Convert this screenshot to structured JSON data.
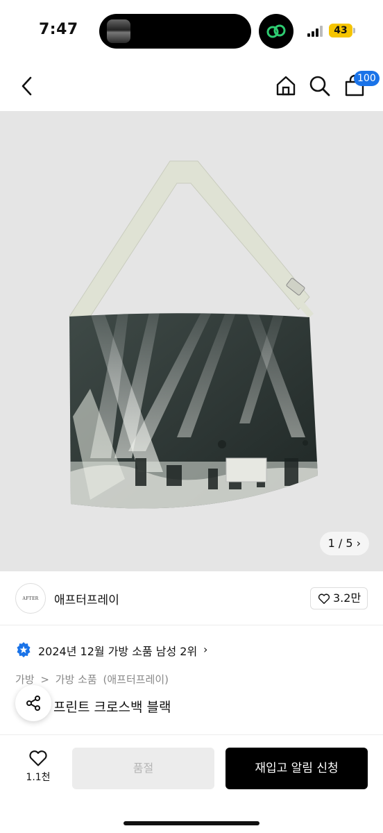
{
  "status_bar": {
    "time": "7:47",
    "battery": "43"
  },
  "nav": {
    "cart_count": "100"
  },
  "gallery": {
    "counter": "1 / 5",
    "chevron": "›"
  },
  "brand": {
    "logo_text": "AFTER PRAY",
    "name": "애프터프레이",
    "likes": "3.2만"
  },
  "ranking": {
    "text": "2024년 12월 가방 소품 남성 2위",
    "chevron": "›"
  },
  "breadcrumb": {
    "level1": "가방",
    "sep": ">",
    "level2": "가방 소품",
    "brand": "(애프터프레이)"
  },
  "product": {
    "title_visible": "나 풀 프린트 크로스백 블랙"
  },
  "bottom_bar": {
    "wish_count": "1.1천",
    "soldout_label": "품절",
    "restock_label": "재입고 알림 신청"
  },
  "colors": {
    "accent_blue": "#1a73e8",
    "battery_yellow": "#f5c400",
    "app_green": "#2ecc71"
  },
  "icons": [
    "back-icon",
    "home-icon",
    "search-icon",
    "shopping-bag-icon",
    "heart-icon",
    "share-icon",
    "rank-badge-icon"
  ]
}
